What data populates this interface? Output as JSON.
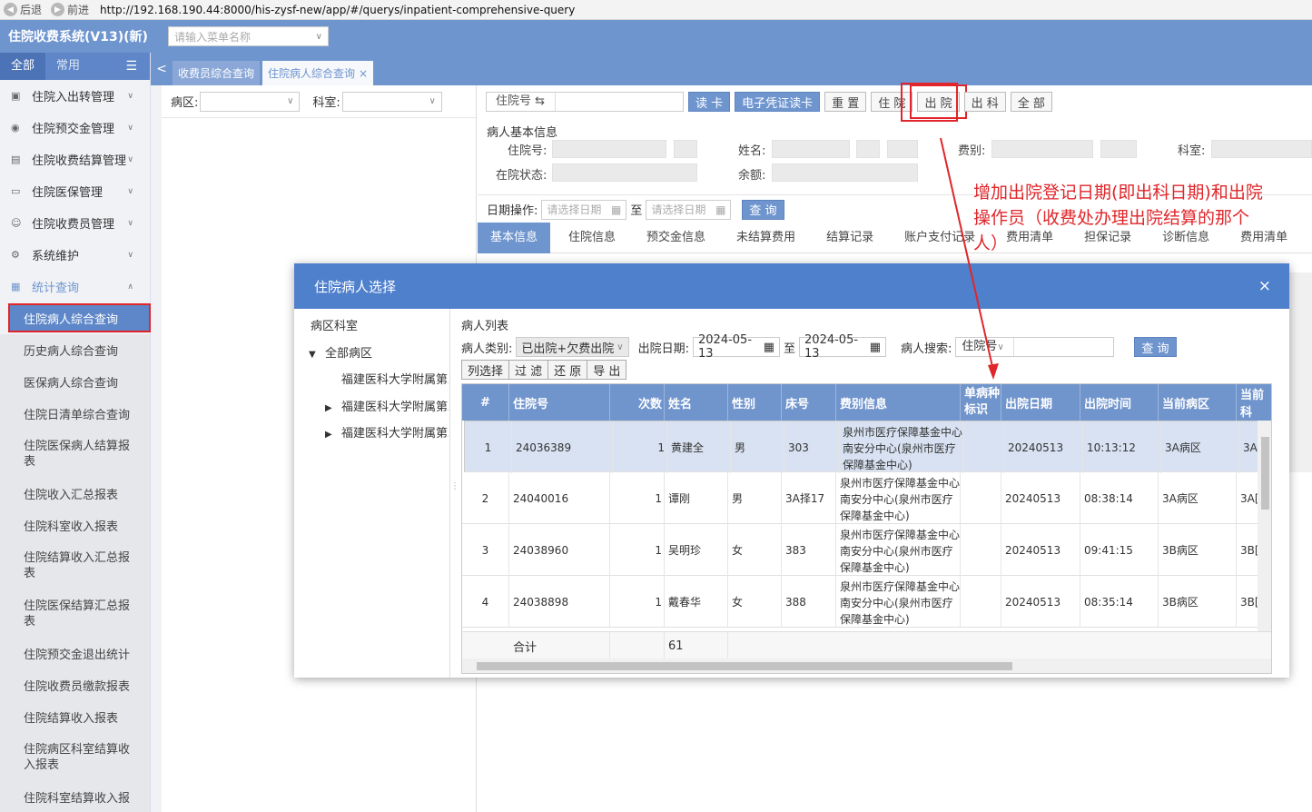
{
  "browser": {
    "back": "后退",
    "forward": "前进",
    "url": "http://192.168.190.44:8000/his-zysf-new/app/#/querys/inpatient-comprehensive-query"
  },
  "app": {
    "title": "住院收费系统(V13)(新)",
    "menu_search_placeholder": "请输入菜单名称"
  },
  "sidebar": {
    "tabs": [
      "全部",
      "常用"
    ],
    "groups": [
      {
        "label": "住院入出转管理"
      },
      {
        "label": "住院预交金管理"
      },
      {
        "label": "住院收费结算管理"
      },
      {
        "label": "住院医保管理"
      },
      {
        "label": "住院收费员管理"
      },
      {
        "label": "系统维护"
      },
      {
        "label": "统计查询"
      }
    ],
    "items": [
      "住院病人综合查询",
      "历史病人综合查询",
      "医保病人综合查询",
      "住院日清单综合查询",
      "住院医保病人结算报表",
      "住院收入汇总报表",
      "住院科室收入报表",
      "住院结算收入汇总报表",
      "住院医保结算汇总报表",
      "住院预交金退出统计",
      "住院收费员缴款报表",
      "住院结算收入报表",
      "住院病区科室结算收入报表",
      "住院科室结算收入报"
    ]
  },
  "tabs": {
    "tab1": "收费员综合查询",
    "tab2": "住院病人综合查询",
    "close": "×"
  },
  "filter": {
    "ward_label": "病区:",
    "dept_label": "科室:"
  },
  "toolbar": {
    "key_label": "住院号 ⇆",
    "read_card": "读 卡",
    "e_card": "电子凭证读卡",
    "reset": "重 置",
    "inpatient": "住 院",
    "discharge": "出 院",
    "out_dept": "出 科",
    "all": "全 部"
  },
  "patient_info": {
    "title": "病人基本信息",
    "inpatient_no": "住院号:",
    "status": "在院状态:",
    "name": "姓名:",
    "balance": "余额:",
    "fee_type": "费别:",
    "dept": "科室:"
  },
  "date_op": {
    "label": "日期操作:",
    "placeholder": "请选择日期",
    "to": "至",
    "query": "查 询"
  },
  "info_tabs": [
    "基本信息",
    "住院信息",
    "预交金信息",
    "未结算费用",
    "结算记录",
    "账户支付记录",
    "费用清单",
    "担保记录",
    "诊断信息",
    "费用清单"
  ],
  "annotation": "增加出院登记日期(即出科日期)和出院操作员（收费处办理出院结算的那个人）",
  "modal": {
    "title": "住院病人选择",
    "close": "×",
    "tree_title": "病区科室",
    "tree_root": "全部病区",
    "tree_children": [
      "福建医科大学附属第二医院",
      "福建医科大学附属第二医院",
      "福建医科大学附属第二医院"
    ],
    "list_title": "病人列表",
    "type_label": "病人类别:",
    "type_value": "已出院+欠费出院",
    "date_label": "出院日期:",
    "date_from": "2024-05-13",
    "date_to": "2024-05-13",
    "to": "至",
    "search_label": "病人搜索:",
    "search_key": "住院号",
    "query": "查 询",
    "btns": [
      "列选择",
      "过 滤",
      "还 原",
      "导 出"
    ],
    "columns": [
      "#",
      "住院号",
      "次数",
      "姓名",
      "性别",
      "床号",
      "费别信息",
      "单病种标识",
      "出院日期",
      "出院时间",
      "当前病区",
      "当前科"
    ],
    "rows": [
      {
        "idx": "1",
        "no": "24036389",
        "times": "1",
        "name": "黄建全",
        "sex": "男",
        "bed": "303",
        "fee": "泉州市医疗保障基金中心南安分中心(泉州市医疗保障基金中心)",
        "single": "",
        "date": "20240513",
        "time": "10:13:12",
        "ward": "3A病区",
        "dept": "3A["
      },
      {
        "idx": "2",
        "no": "24040016",
        "times": "1",
        "name": "谭刚",
        "sex": "男",
        "bed": "3A择17",
        "fee": "泉州市医疗保障基金中心南安分中心(泉州市医疗保障基金中心)",
        "single": "",
        "date": "20240513",
        "time": "08:38:14",
        "ward": "3A病区",
        "dept": "3A["
      },
      {
        "idx": "3",
        "no": "24038960",
        "times": "1",
        "name": "吴明珍",
        "sex": "女",
        "bed": "383",
        "fee": "泉州市医疗保障基金中心南安分中心(泉州市医疗保障基金中心)",
        "single": "",
        "date": "20240513",
        "time": "09:41:15",
        "ward": "3B病区",
        "dept": "3B["
      },
      {
        "idx": "4",
        "no": "24038898",
        "times": "1",
        "name": "戴春华",
        "sex": "女",
        "bed": "388",
        "fee": "泉州市医疗保障基金中心南安分中心(泉州市医疗保障基金中心)",
        "single": "",
        "date": "20240513",
        "time": "08:35:14",
        "ward": "3B病区",
        "dept": "3B["
      }
    ],
    "sum_label": "合计",
    "sum_count": "61"
  },
  "colors": {
    "primary": "#6f95cf",
    "header": "#4f80cc",
    "highlight": "#e0262a"
  }
}
